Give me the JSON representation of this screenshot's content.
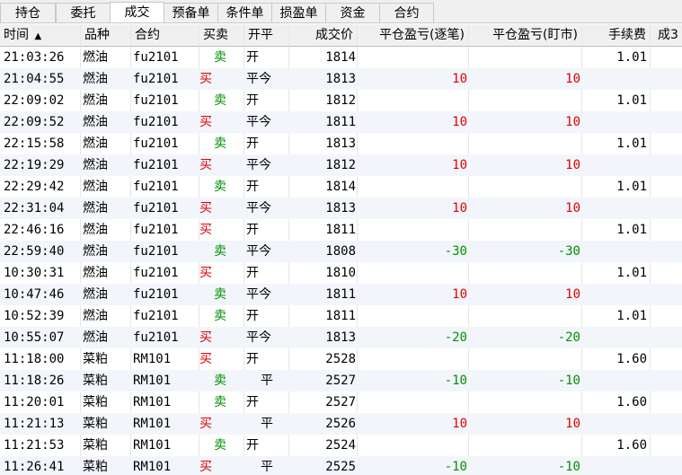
{
  "tabs": [
    {
      "label": "持仓"
    },
    {
      "label": "委托"
    },
    {
      "label": "成交",
      "active": true
    },
    {
      "label": "预备单"
    },
    {
      "label": "条件单"
    },
    {
      "label": "损盈单"
    },
    {
      "label": "资金"
    },
    {
      "label": "合约"
    }
  ],
  "columns": {
    "time": "时间",
    "sort_indicator": "▲",
    "product": "品种",
    "contract": "合约",
    "side": "买卖",
    "open_close": "开平",
    "price": "成交价",
    "pnl_trade": "平仓盈亏(逐笔)",
    "pnl_mark": "平仓盈亏(盯市)",
    "fee": "手续费",
    "truncated": "成3"
  },
  "colors": {
    "buy": "#e00000",
    "sell": "#009000",
    "loss": "#009000",
    "profit": "#e00000"
  },
  "trades": [
    {
      "time": "21:03:26",
      "product": "燃油",
      "contract": "fu2101",
      "side": "卖",
      "oc": "开",
      "price": "1814",
      "pnl_trade": "",
      "pnl_mark": "",
      "fee": "1.01"
    },
    {
      "time": "21:04:55",
      "product": "燃油",
      "contract": "fu2101",
      "side": "买",
      "oc": "平今",
      "price": "1813",
      "pnl_trade": "10",
      "pnl_mark": "10",
      "fee": ""
    },
    {
      "time": "22:09:02",
      "product": "燃油",
      "contract": "fu2101",
      "side": "卖",
      "oc": "开",
      "price": "1812",
      "pnl_trade": "",
      "pnl_mark": "",
      "fee": "1.01"
    },
    {
      "time": "22:09:52",
      "product": "燃油",
      "contract": "fu2101",
      "side": "买",
      "oc": "平今",
      "price": "1811",
      "pnl_trade": "10",
      "pnl_mark": "10",
      "fee": ""
    },
    {
      "time": "22:15:58",
      "product": "燃油",
      "contract": "fu2101",
      "side": "卖",
      "oc": "开",
      "price": "1813",
      "pnl_trade": "",
      "pnl_mark": "",
      "fee": "1.01"
    },
    {
      "time": "22:19:29",
      "product": "燃油",
      "contract": "fu2101",
      "side": "买",
      "oc": "平今",
      "price": "1812",
      "pnl_trade": "10",
      "pnl_mark": "10",
      "fee": ""
    },
    {
      "time": "22:29:42",
      "product": "燃油",
      "contract": "fu2101",
      "side": "卖",
      "oc": "开",
      "price": "1814",
      "pnl_trade": "",
      "pnl_mark": "",
      "fee": "1.01"
    },
    {
      "time": "22:31:04",
      "product": "燃油",
      "contract": "fu2101",
      "side": "买",
      "oc": "平今",
      "price": "1813",
      "pnl_trade": "10",
      "pnl_mark": "10",
      "fee": ""
    },
    {
      "time": "22:46:16",
      "product": "燃油",
      "contract": "fu2101",
      "side": "买",
      "oc": "开",
      "price": "1811",
      "pnl_trade": "",
      "pnl_mark": "",
      "fee": "1.01"
    },
    {
      "time": "22:59:40",
      "product": "燃油",
      "contract": "fu2101",
      "side": "卖",
      "oc": "平今",
      "price": "1808",
      "pnl_trade": "-30",
      "pnl_mark": "-30",
      "fee": ""
    },
    {
      "time": "10:30:31",
      "product": "燃油",
      "contract": "fu2101",
      "side": "买",
      "oc": "开",
      "price": "1810",
      "pnl_trade": "",
      "pnl_mark": "",
      "fee": "1.01"
    },
    {
      "time": "10:47:46",
      "product": "燃油",
      "contract": "fu2101",
      "side": "卖",
      "oc": "平今",
      "price": "1811",
      "pnl_trade": "10",
      "pnl_mark": "10",
      "fee": ""
    },
    {
      "time": "10:52:39",
      "product": "燃油",
      "contract": "fu2101",
      "side": "卖",
      "oc": "开",
      "price": "1811",
      "pnl_trade": "",
      "pnl_mark": "",
      "fee": "1.01"
    },
    {
      "time": "10:55:07",
      "product": "燃油",
      "contract": "fu2101",
      "side": "买",
      "oc": "平今",
      "price": "1813",
      "pnl_trade": "-20",
      "pnl_mark": "-20",
      "fee": ""
    },
    {
      "time": "11:18:00",
      "product": "菜粕",
      "contract": "RM101",
      "side": "买",
      "oc": "开",
      "price": "2528",
      "pnl_trade": "",
      "pnl_mark": "",
      "fee": "1.60"
    },
    {
      "time": "11:18:26",
      "product": "菜粕",
      "contract": "RM101",
      "side": "卖",
      "oc": "平",
      "price": "2527",
      "pnl_trade": "-10",
      "pnl_mark": "-10",
      "fee": ""
    },
    {
      "time": "11:20:01",
      "product": "菜粕",
      "contract": "RM101",
      "side": "卖",
      "oc": "开",
      "price": "2527",
      "pnl_trade": "",
      "pnl_mark": "",
      "fee": "1.60"
    },
    {
      "time": "11:21:13",
      "product": "菜粕",
      "contract": "RM101",
      "side": "买",
      "oc": "平",
      "price": "2526",
      "pnl_trade": "10",
      "pnl_mark": "10",
      "fee": ""
    },
    {
      "time": "11:21:53",
      "product": "菜粕",
      "contract": "RM101",
      "side": "卖",
      "oc": "开",
      "price": "2524",
      "pnl_trade": "",
      "pnl_mark": "",
      "fee": "1.60"
    },
    {
      "time": "11:26:41",
      "product": "菜粕",
      "contract": "RM101",
      "side": "买",
      "oc": "平",
      "price": "2525",
      "pnl_trade": "-10",
      "pnl_mark": "-10",
      "fee": ""
    }
  ]
}
